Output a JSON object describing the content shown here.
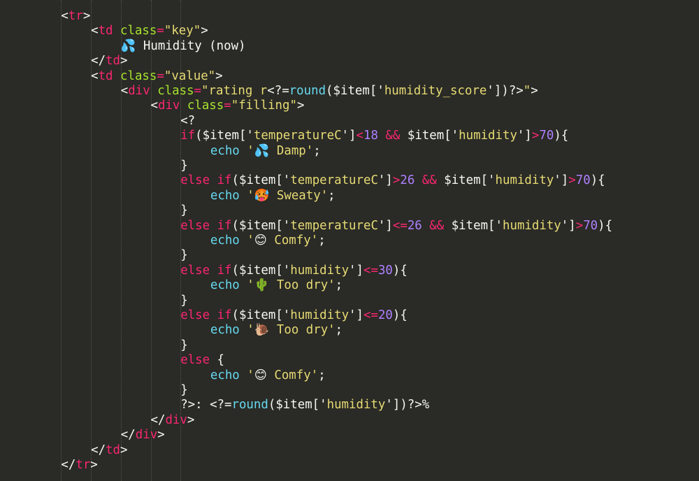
{
  "editor": {
    "background": "#2a2a26",
    "theme_colors": {
      "tag": "#f92672",
      "attribute": "#a6e22e",
      "string": "#e6db74",
      "keyword": "#f92672",
      "number": "#ae81ff",
      "function": "#66d9ef",
      "text": "#f8f8f2"
    },
    "lines": [
      {
        "indent": 2,
        "tokens": [
          [
            "punc",
            "<"
          ],
          [
            "tag",
            "tr"
          ],
          [
            "punc",
            ">"
          ]
        ]
      },
      {
        "indent": 3,
        "tokens": [
          [
            "punc",
            "<"
          ],
          [
            "tag",
            "td"
          ],
          [
            "plain",
            " "
          ],
          [
            "attr",
            "class"
          ],
          [
            "op",
            "="
          ],
          [
            "str",
            "\"key\""
          ],
          [
            "punc",
            ">"
          ]
        ]
      },
      {
        "indent": 4,
        "tokens": [
          [
            "emoji",
            "💦"
          ],
          [
            "plain",
            " Humidity (now)"
          ]
        ]
      },
      {
        "indent": 3,
        "tokens": [
          [
            "punc",
            "</"
          ],
          [
            "tag",
            "td"
          ],
          [
            "punc",
            ">"
          ]
        ]
      },
      {
        "indent": 3,
        "tokens": [
          [
            "punc",
            "<"
          ],
          [
            "tag",
            "td"
          ],
          [
            "plain",
            " "
          ],
          [
            "attr",
            "class"
          ],
          [
            "op",
            "="
          ],
          [
            "str",
            "\"value\""
          ],
          [
            "punc",
            ">"
          ]
        ]
      },
      {
        "indent": 4,
        "tokens": [
          [
            "punc",
            "<"
          ],
          [
            "tag",
            "div"
          ],
          [
            "plain",
            " "
          ],
          [
            "attr",
            "class"
          ],
          [
            "op",
            "="
          ],
          [
            "str",
            "\"rating r"
          ],
          [
            "punc",
            "<?="
          ],
          [
            "func",
            "round"
          ],
          [
            "punc",
            "($item['"
          ],
          [
            "str",
            "humidity_score"
          ],
          [
            "punc",
            "'])?>"
          ],
          [
            "str",
            "\""
          ],
          [
            "punc",
            ">"
          ]
        ]
      },
      {
        "indent": 5,
        "tokens": [
          [
            "punc",
            "<"
          ],
          [
            "tag",
            "div"
          ],
          [
            "plain",
            " "
          ],
          [
            "attr",
            "class"
          ],
          [
            "op",
            "="
          ],
          [
            "str",
            "\"filling\""
          ],
          [
            "punc",
            ">"
          ]
        ]
      },
      {
        "indent": 6,
        "tokens": [
          [
            "punc",
            "<?"
          ]
        ]
      },
      {
        "indent": 6,
        "tokens": [
          [
            "kw",
            "if"
          ],
          [
            "punc",
            "($item['"
          ],
          [
            "str",
            "temperatureC"
          ],
          [
            "punc",
            "']"
          ],
          [
            "op",
            "<"
          ],
          [
            "num",
            "18"
          ],
          [
            "plain",
            " "
          ],
          [
            "op",
            "&&"
          ],
          [
            "plain",
            " "
          ],
          [
            "punc",
            "$item['"
          ],
          [
            "str",
            "humidity"
          ],
          [
            "punc",
            "']"
          ],
          [
            "op",
            ">"
          ],
          [
            "num",
            "70"
          ],
          [
            "punc",
            "){"
          ]
        ]
      },
      {
        "indent": 7,
        "tokens": [
          [
            "func",
            "echo"
          ],
          [
            "plain",
            " "
          ],
          [
            "str",
            "'"
          ],
          [
            "emoji",
            "💦"
          ],
          [
            "str",
            " Damp'"
          ],
          [
            "punc",
            ";"
          ]
        ]
      },
      {
        "indent": 6,
        "tokens": [
          [
            "punc",
            "}"
          ]
        ]
      },
      {
        "indent": 6,
        "tokens": [
          [
            "kw",
            "else"
          ],
          [
            "plain",
            " "
          ],
          [
            "kw",
            "if"
          ],
          [
            "punc",
            "($item['"
          ],
          [
            "str",
            "temperatureC"
          ],
          [
            "punc",
            "']"
          ],
          [
            "op",
            ">"
          ],
          [
            "num",
            "26"
          ],
          [
            "plain",
            " "
          ],
          [
            "op",
            "&&"
          ],
          [
            "plain",
            " "
          ],
          [
            "punc",
            "$item['"
          ],
          [
            "str",
            "humidity"
          ],
          [
            "punc",
            "']"
          ],
          [
            "op",
            ">"
          ],
          [
            "num",
            "70"
          ],
          [
            "punc",
            "){"
          ]
        ]
      },
      {
        "indent": 7,
        "tokens": [
          [
            "func",
            "echo"
          ],
          [
            "plain",
            " "
          ],
          [
            "str",
            "'"
          ],
          [
            "emoji",
            "🥵"
          ],
          [
            "str",
            " Sweaty'"
          ],
          [
            "punc",
            ";"
          ]
        ]
      },
      {
        "indent": 6,
        "tokens": [
          [
            "punc",
            "}"
          ]
        ]
      },
      {
        "indent": 6,
        "tokens": [
          [
            "kw",
            "else"
          ],
          [
            "plain",
            " "
          ],
          [
            "kw",
            "if"
          ],
          [
            "punc",
            "($item['"
          ],
          [
            "str",
            "temperatureC"
          ],
          [
            "punc",
            "']"
          ],
          [
            "op",
            "<="
          ],
          [
            "num",
            "26"
          ],
          [
            "plain",
            " "
          ],
          [
            "op",
            "&&"
          ],
          [
            "plain",
            " "
          ],
          [
            "punc",
            "$item['"
          ],
          [
            "str",
            "humidity"
          ],
          [
            "punc",
            "']"
          ],
          [
            "op",
            ">"
          ],
          [
            "num",
            "70"
          ],
          [
            "punc",
            "){"
          ]
        ]
      },
      {
        "indent": 7,
        "tokens": [
          [
            "func",
            "echo"
          ],
          [
            "plain",
            " "
          ],
          [
            "str",
            "'"
          ],
          [
            "emoji",
            "😊"
          ],
          [
            "str",
            " Comfy'"
          ],
          [
            "punc",
            ";"
          ]
        ]
      },
      {
        "indent": 6,
        "tokens": [
          [
            "punc",
            "}"
          ]
        ]
      },
      {
        "indent": 6,
        "tokens": [
          [
            "kw",
            "else"
          ],
          [
            "plain",
            " "
          ],
          [
            "kw",
            "if"
          ],
          [
            "punc",
            "($item['"
          ],
          [
            "str",
            "humidity"
          ],
          [
            "punc",
            "']"
          ],
          [
            "op",
            "<="
          ],
          [
            "num",
            "30"
          ],
          [
            "punc",
            "){"
          ]
        ]
      },
      {
        "indent": 7,
        "tokens": [
          [
            "func",
            "echo"
          ],
          [
            "plain",
            " "
          ],
          [
            "str",
            "'"
          ],
          [
            "emoji",
            "🌵"
          ],
          [
            "str",
            " Too dry'"
          ],
          [
            "punc",
            ";"
          ]
        ]
      },
      {
        "indent": 6,
        "tokens": [
          [
            "punc",
            "}"
          ]
        ]
      },
      {
        "indent": 6,
        "tokens": [
          [
            "kw",
            "else"
          ],
          [
            "plain",
            " "
          ],
          [
            "kw",
            "if"
          ],
          [
            "punc",
            "($item['"
          ],
          [
            "str",
            "humidity"
          ],
          [
            "punc",
            "']"
          ],
          [
            "op",
            "<="
          ],
          [
            "num",
            "20"
          ],
          [
            "punc",
            "){"
          ]
        ]
      },
      {
        "indent": 7,
        "tokens": [
          [
            "func",
            "echo"
          ],
          [
            "plain",
            " "
          ],
          [
            "str",
            "'"
          ],
          [
            "emoji",
            "🐌"
          ],
          [
            "str",
            " Too dry'"
          ],
          [
            "punc",
            ";"
          ]
        ]
      },
      {
        "indent": 6,
        "tokens": [
          [
            "punc",
            "}"
          ]
        ]
      },
      {
        "indent": 6,
        "tokens": [
          [
            "kw",
            "else"
          ],
          [
            "plain",
            " {"
          ]
        ]
      },
      {
        "indent": 7,
        "tokens": [
          [
            "func",
            "echo"
          ],
          [
            "plain",
            " "
          ],
          [
            "str",
            "'"
          ],
          [
            "emoji",
            "😊"
          ],
          [
            "str",
            " Comfy'"
          ],
          [
            "punc",
            ";"
          ]
        ]
      },
      {
        "indent": 6,
        "tokens": [
          [
            "punc",
            "}"
          ]
        ]
      },
      {
        "indent": 6,
        "tokens": [
          [
            "punc",
            "?>: <?="
          ],
          [
            "func",
            "round"
          ],
          [
            "punc",
            "($item['"
          ],
          [
            "str",
            "humidity"
          ],
          [
            "punc",
            "'])?>%"
          ]
        ]
      },
      {
        "indent": 5,
        "tokens": [
          [
            "punc",
            "</"
          ],
          [
            "tag",
            "div"
          ],
          [
            "punc",
            ">"
          ]
        ]
      },
      {
        "indent": 4,
        "tokens": [
          [
            "punc",
            "</"
          ],
          [
            "tag",
            "div"
          ],
          [
            "punc",
            ">"
          ]
        ]
      },
      {
        "indent": 3,
        "tokens": [
          [
            "punc",
            "</"
          ],
          [
            "tag",
            "td"
          ],
          [
            "punc",
            ">"
          ]
        ]
      },
      {
        "indent": 2,
        "tokens": [
          [
            "punc",
            "</"
          ],
          [
            "tag",
            "tr"
          ],
          [
            "punc",
            ">"
          ]
        ]
      }
    ]
  }
}
